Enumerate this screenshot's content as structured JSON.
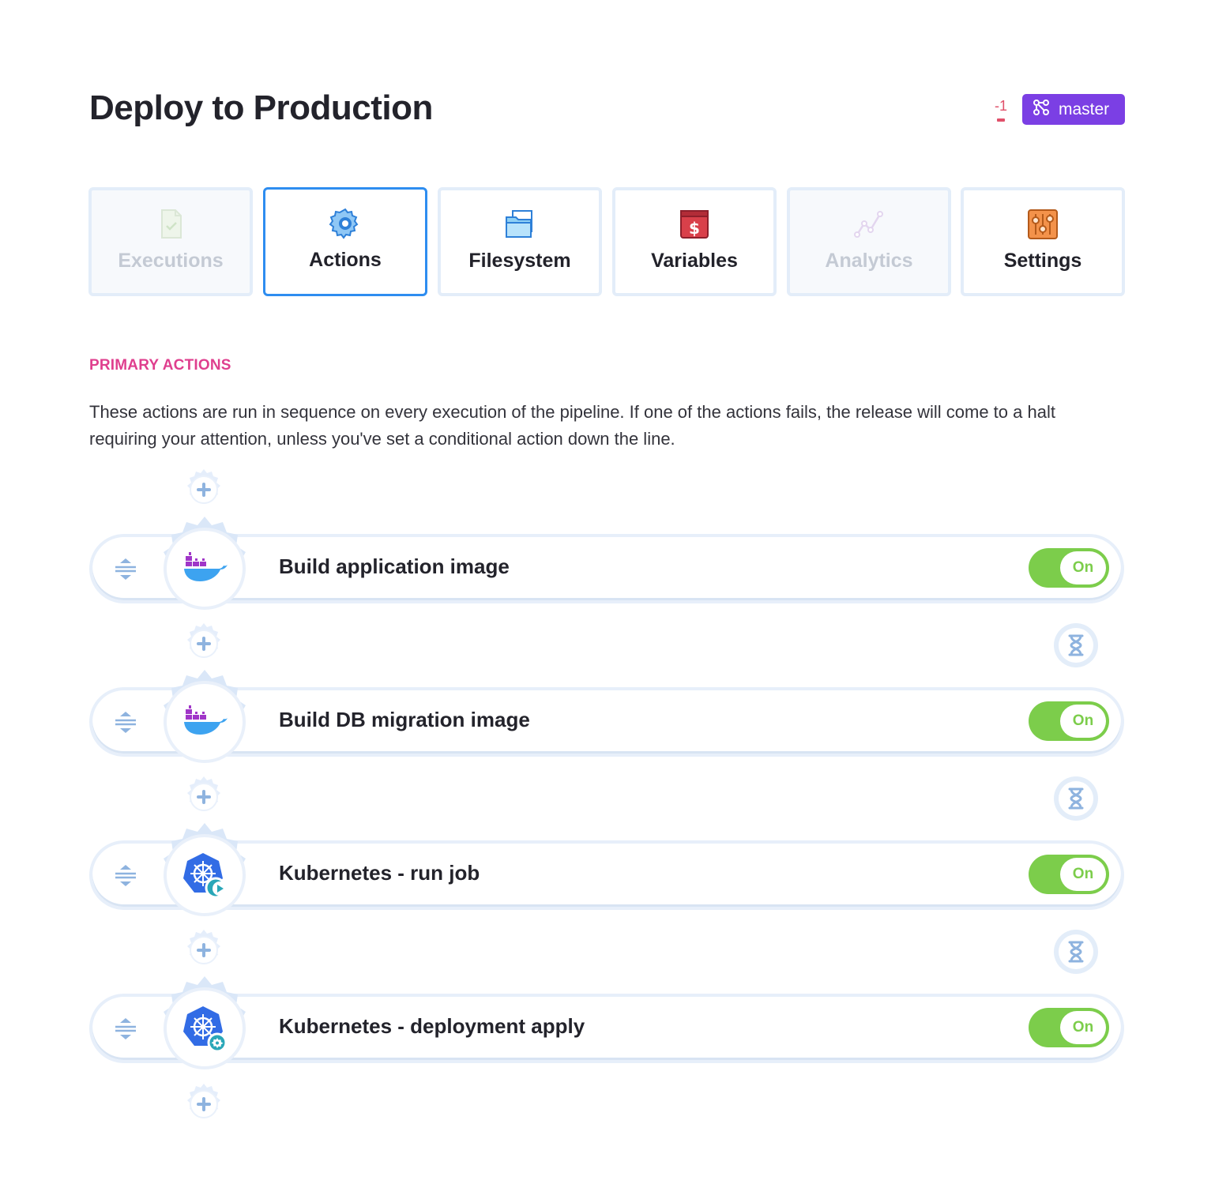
{
  "header": {
    "title": "Deploy to Production",
    "diff_count": "-1",
    "branch_label": "master",
    "branch_icon": "git-branch-icon"
  },
  "colors": {
    "accent": "#2e8df0",
    "branch_bg": "#7b3fe4",
    "section_title": "#df3f8e",
    "toggle_on": "#7ccd4b",
    "diff": "#e0506a"
  },
  "tabs": [
    {
      "label": "Executions",
      "icon": "document-check-icon",
      "enabled": false,
      "active": false
    },
    {
      "label": "Actions",
      "icon": "gear-icon",
      "enabled": true,
      "active": true
    },
    {
      "label": "Filesystem",
      "icon": "folder-icon",
      "enabled": true,
      "active": false
    },
    {
      "label": "Variables",
      "icon": "dollar-icon",
      "enabled": true,
      "active": false
    },
    {
      "label": "Analytics",
      "icon": "line-chart-icon",
      "enabled": false,
      "active": false
    },
    {
      "label": "Settings",
      "icon": "sliders-icon",
      "enabled": true,
      "active": false
    }
  ],
  "section": {
    "title": "PRIMARY ACTIONS",
    "description": "These actions are run in sequence on every execution of the pipeline. If one of the actions fails, the release will come to a halt requiring your attention, unless you've set a conditional action down the line."
  },
  "actions": [
    {
      "name": "Build application image",
      "icon": "docker-icon",
      "toggle_label": "On",
      "enabled": true
    },
    {
      "name": "Build DB migration image",
      "icon": "docker-icon",
      "toggle_label": "On",
      "enabled": true
    },
    {
      "name": "Kubernetes - run job",
      "icon": "kubernetes-run-icon",
      "toggle_label": "On",
      "enabled": true
    },
    {
      "name": "Kubernetes - deployment apply",
      "icon": "kubernetes-apply-icon",
      "toggle_label": "On",
      "enabled": true
    }
  ]
}
